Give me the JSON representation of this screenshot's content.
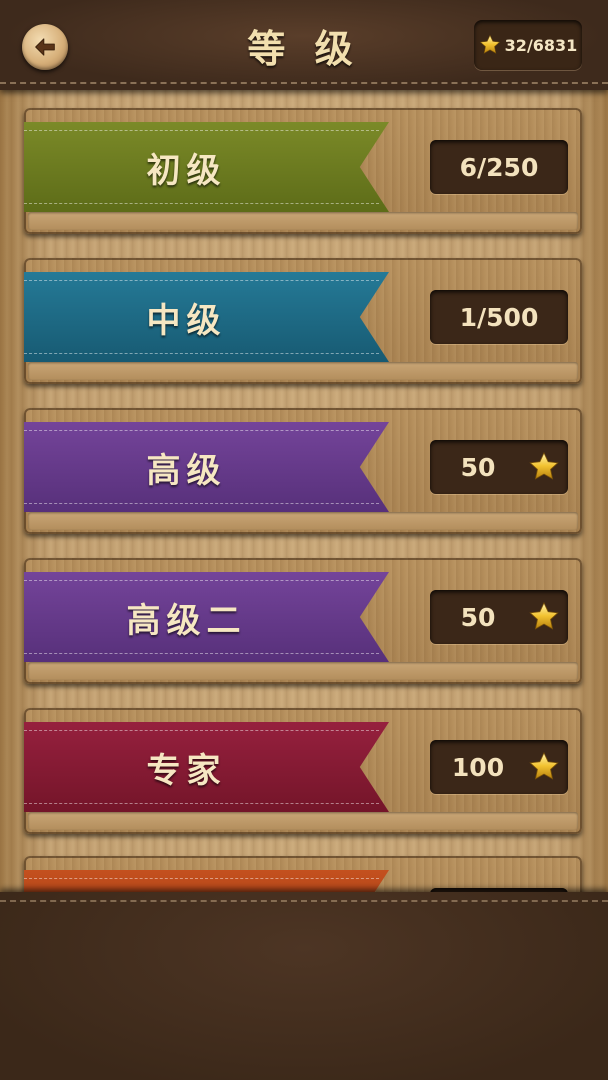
{
  "header": {
    "title": "等 级",
    "back_icon": "back-arrow-icon",
    "star_total": "32/6831"
  },
  "levels": [
    {
      "label": "初级",
      "value": "6/250",
      "has_star": false,
      "color": "#6b7a1f"
    },
    {
      "label": "中级",
      "value": "1/500",
      "has_star": false,
      "color": "#1e6b86"
    },
    {
      "label": "高级",
      "value": "50",
      "has_star": true,
      "color": "#6a3a8c"
    },
    {
      "label": "高级二",
      "value": "50",
      "has_star": true,
      "color": "#6a3a8c"
    },
    {
      "label": "专家",
      "value": "100",
      "has_star": true,
      "color": "#8a1a34"
    },
    {
      "label": "",
      "value": "",
      "has_star": false,
      "color": "#b4441c"
    }
  ],
  "colors": {
    "header_bg": "#3e2a1c",
    "text": "#f3e2bd",
    "star": "#f0c030"
  }
}
